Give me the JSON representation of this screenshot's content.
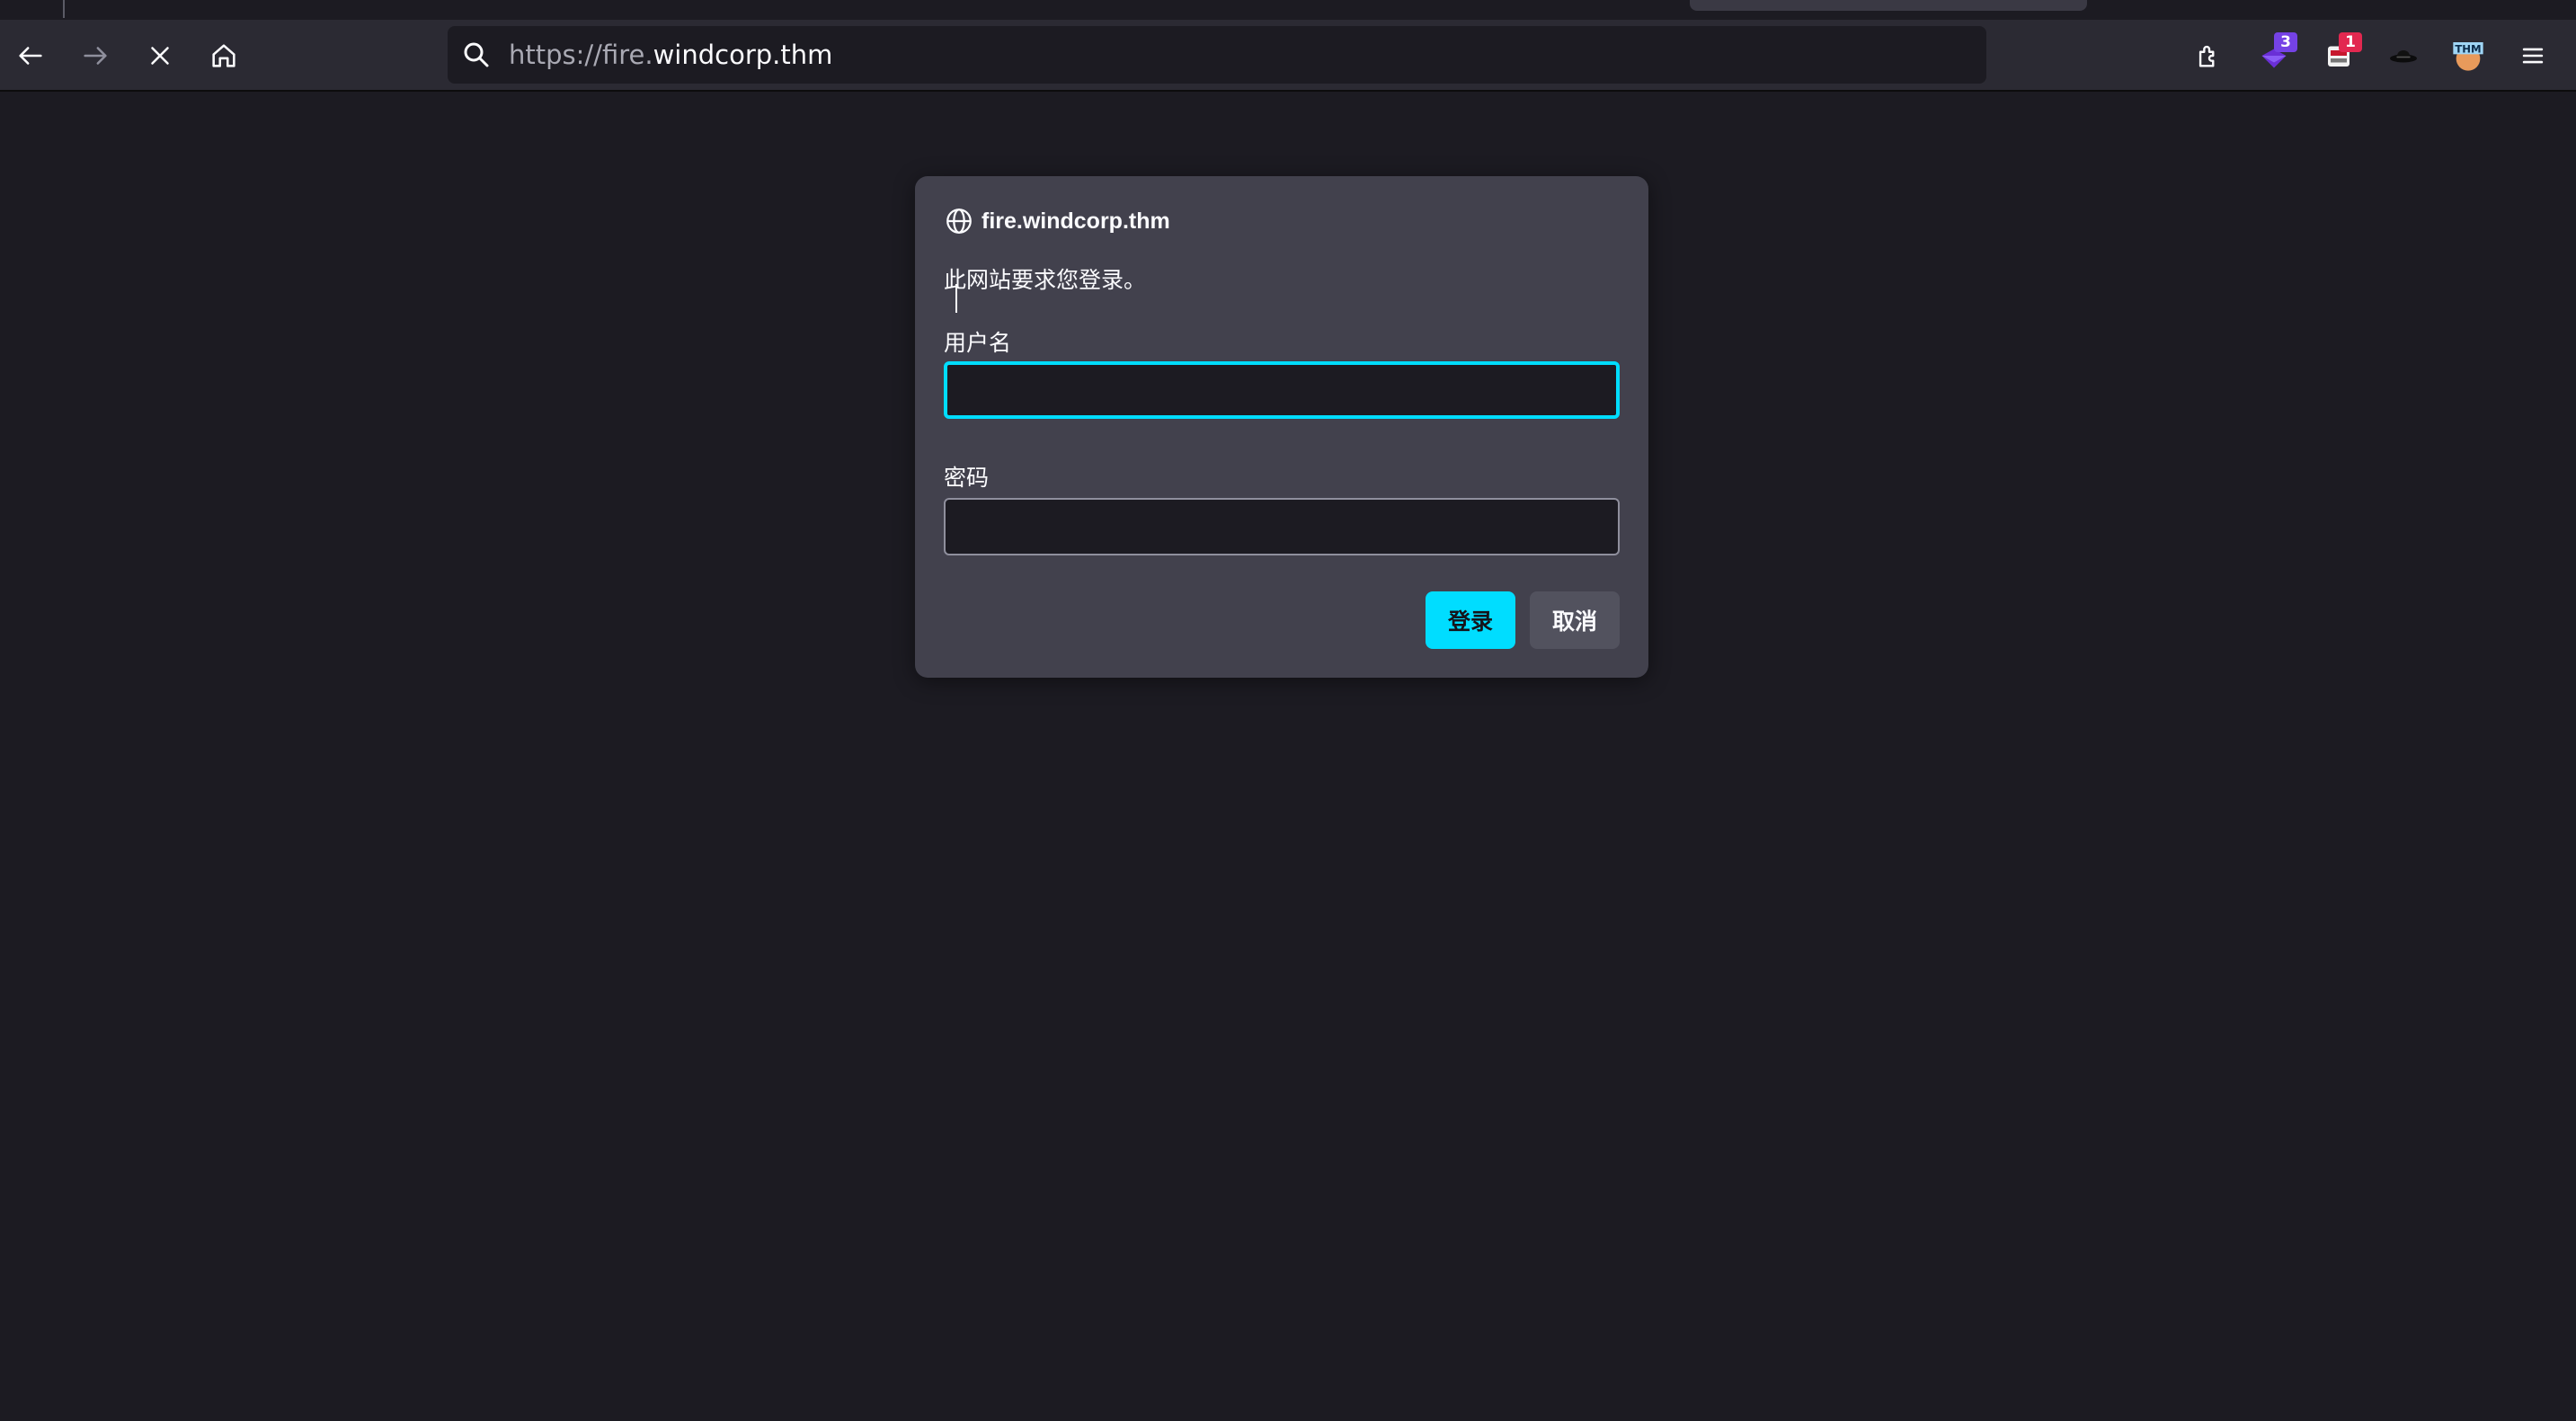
{
  "browser": {
    "url_prefix": "https://fire.",
    "url_domain": "windcorp.thm",
    "extensions": [
      {
        "name": "extension-purple-icon",
        "badge": "3",
        "badge_color": "#7542e5"
      },
      {
        "name": "extension-red-icon",
        "badge": "1",
        "badge_color": "#e22850"
      },
      {
        "name": "extension-hat-icon",
        "badge": null
      },
      {
        "name": "extension-thm-icon",
        "label": "THM",
        "badge": null
      }
    ]
  },
  "auth_dialog": {
    "origin": "fire.windcorp.thm",
    "message": "此网站要求您登录。",
    "username_label": "用户名",
    "username_value": "",
    "password_label": "密码",
    "password_value": "",
    "login_label": "登录",
    "cancel_label": "取消"
  },
  "colors": {
    "accent": "#00ddff",
    "dialog_bg": "#42414d",
    "page_bg": "#1c1b22",
    "toolbar_bg": "#2b2a33"
  }
}
